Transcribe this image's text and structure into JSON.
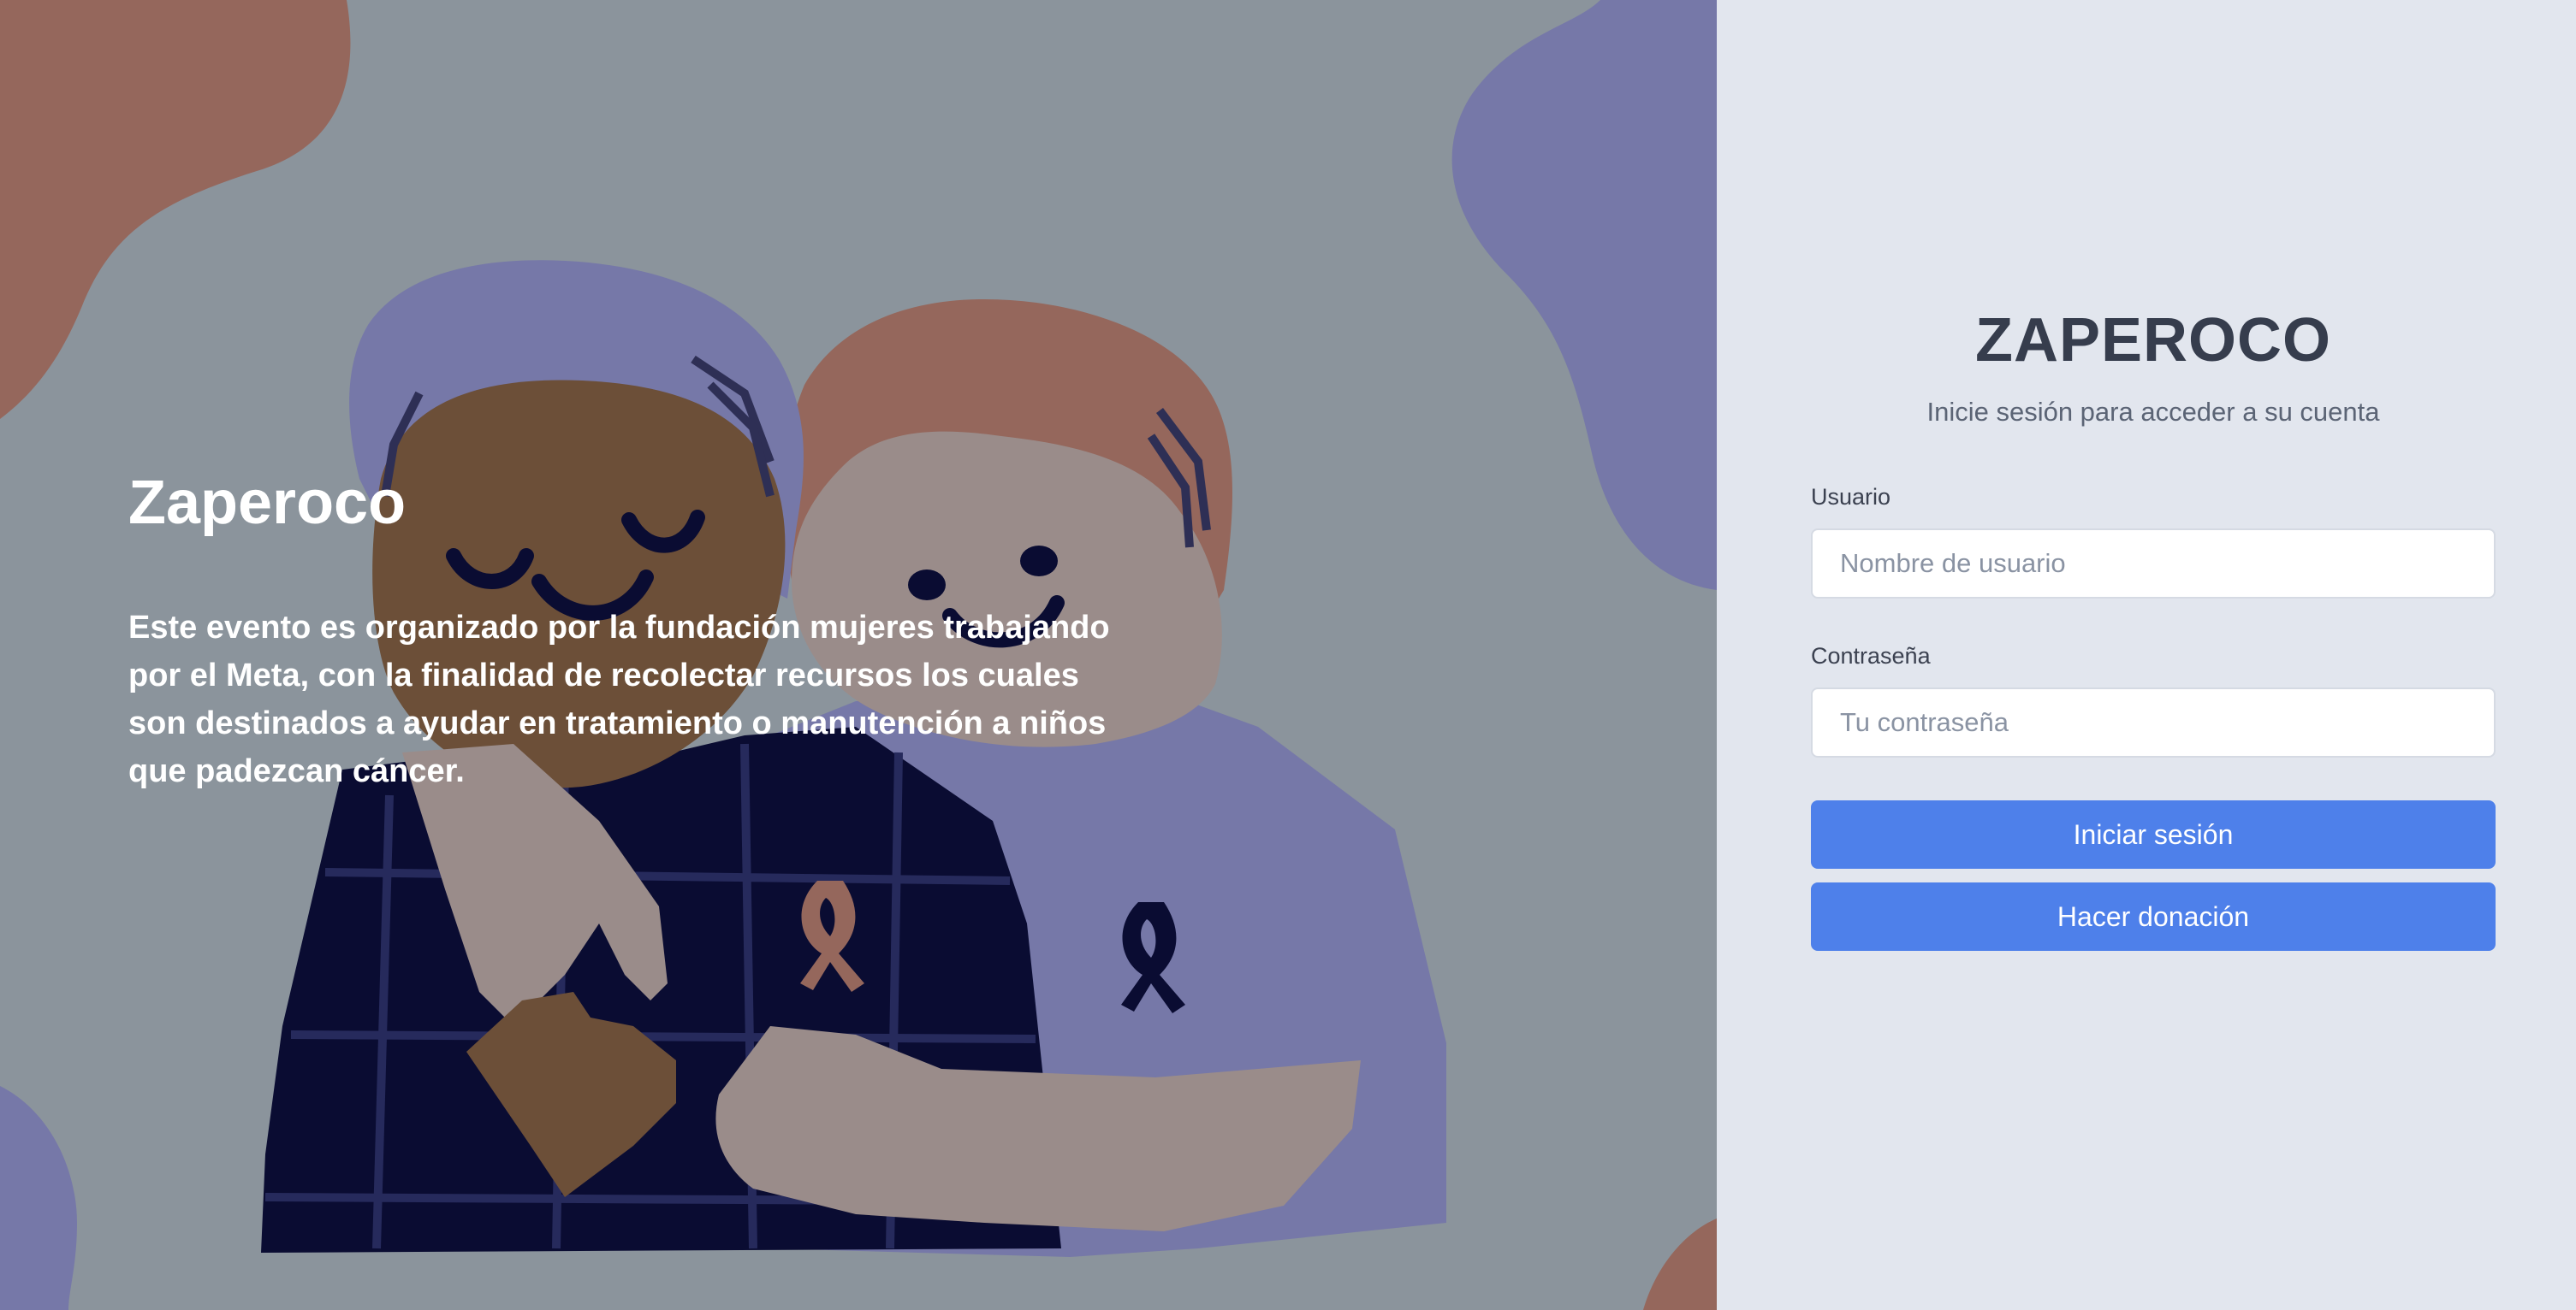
{
  "hero": {
    "title": "Zaperoco",
    "description": "Este evento es organizado por la fundación mujeres trabajando por el Meta, con la finalidad de recolectar recursos los cuales son destinados a ayudar en tratamiento o manutención a niños que padezcan cáncer.",
    "illustration": "two-people-hugging-with-cancer-ribbons"
  },
  "login": {
    "brand": "ZAPEROCO",
    "subtitle": "Inicie sesión para acceder a su cuenta",
    "username_label": "Usuario",
    "username_placeholder": "Nombre de usuario",
    "username_value": "",
    "password_label": "Contraseña",
    "password_placeholder": "Tu contraseña",
    "password_value": "",
    "login_button": "Iniciar sesión",
    "donate_button": "Hacer donación"
  },
  "colors": {
    "hero_background": "#8b949c",
    "panel_background": "#e2e6ee",
    "button": "#4e80ea",
    "brand_text": "#363d4d",
    "blob_terracotta": "#95675c",
    "blob_purple": "#7678a8",
    "navy": "#0a0c32"
  }
}
